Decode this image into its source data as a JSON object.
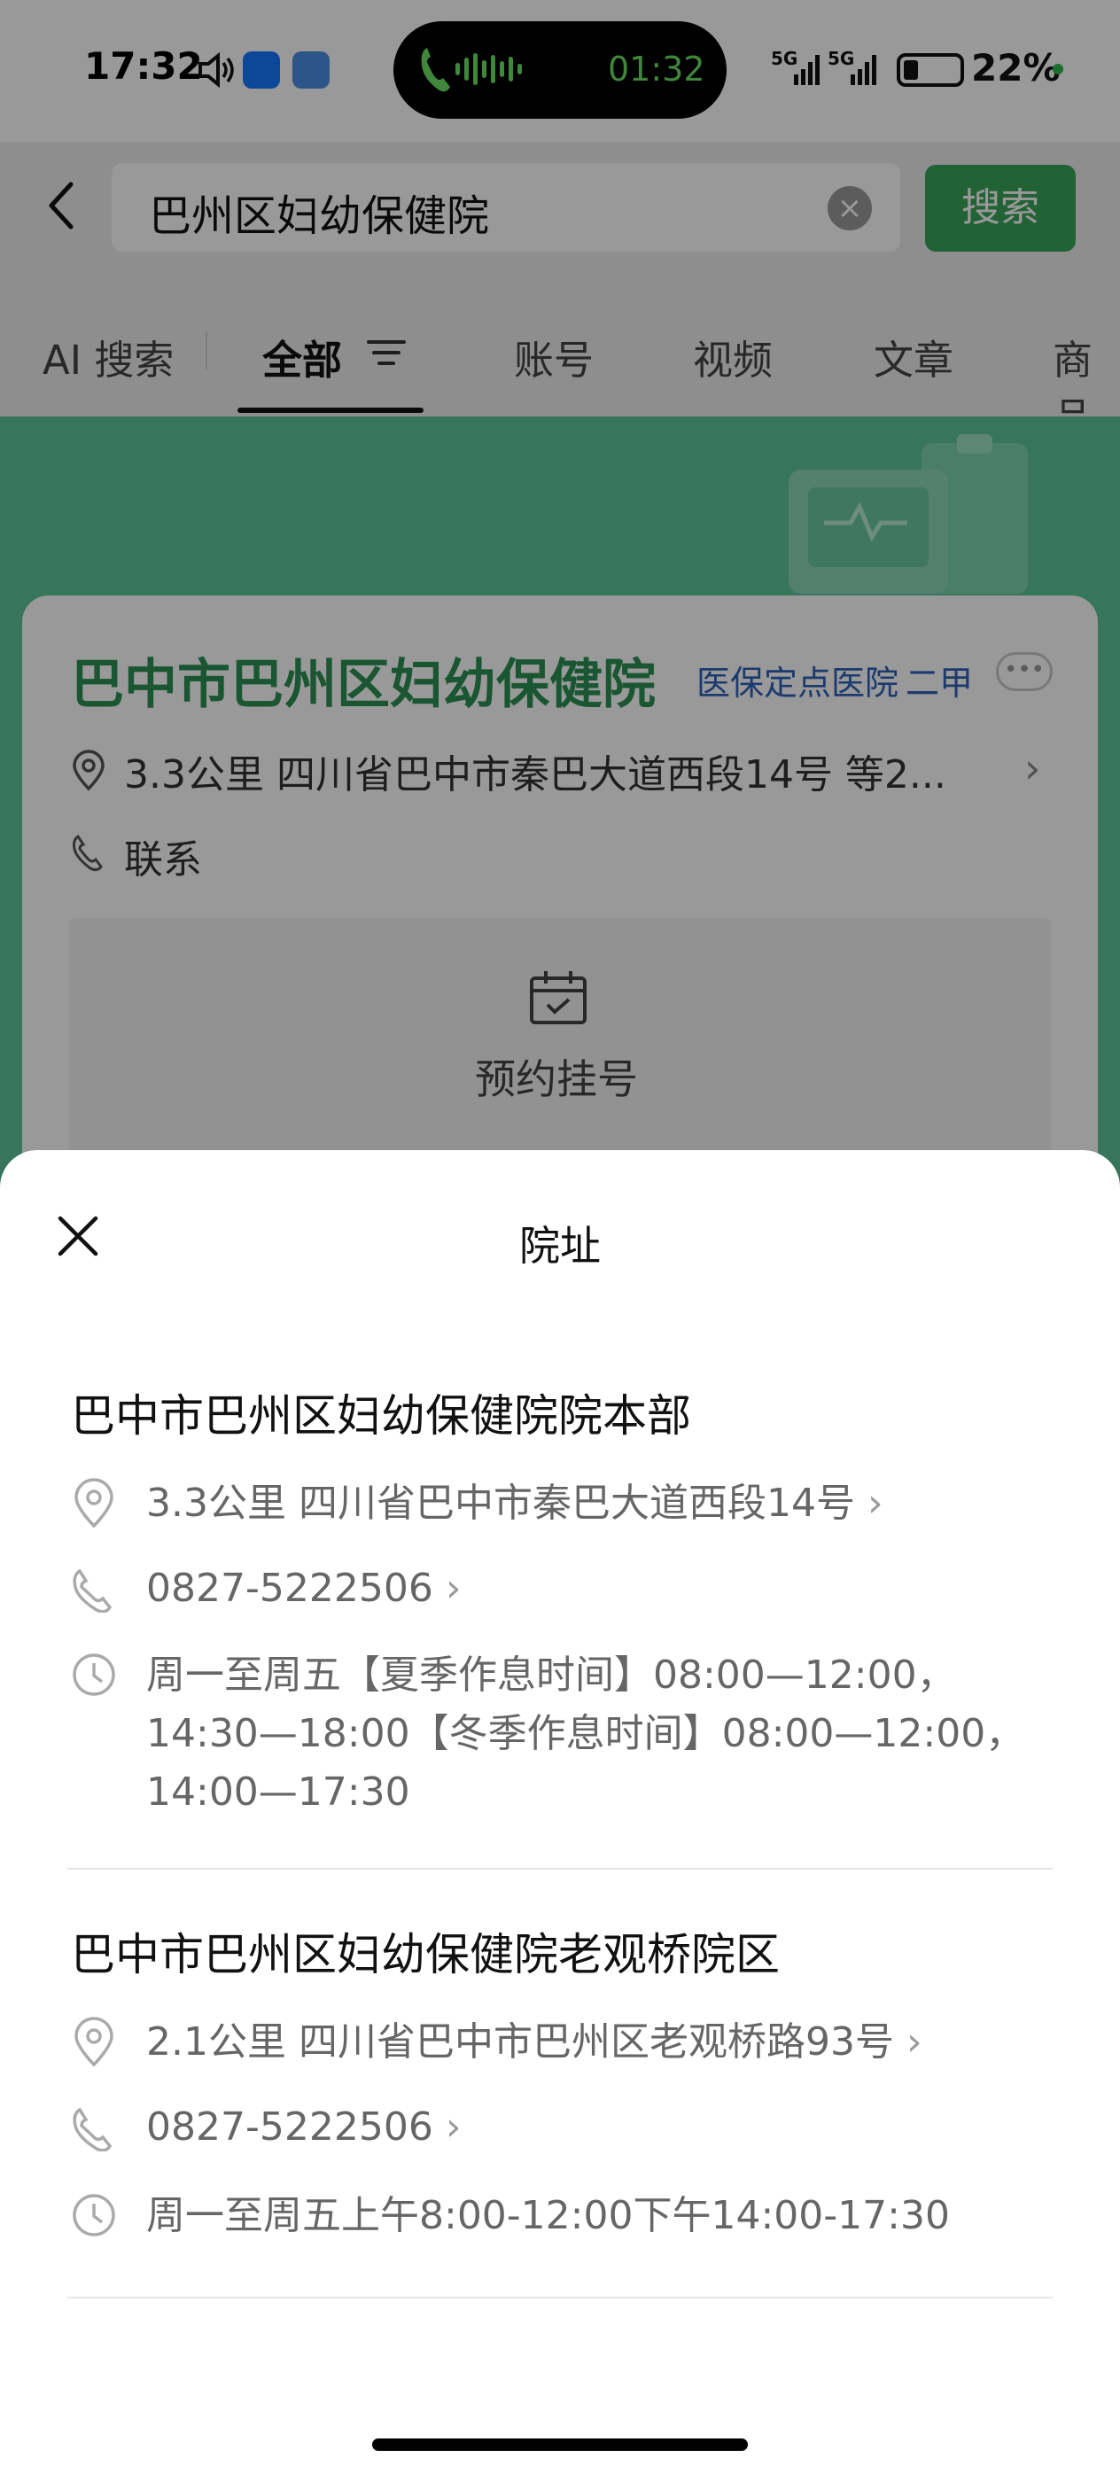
{
  "status_bar": {
    "time": "17:32",
    "call_duration": "01:32",
    "signal_1": "5G",
    "signal_2": "5G",
    "battery": "22%"
  },
  "search": {
    "query": "巴州区妇幼保健院",
    "button_label": "搜索"
  },
  "tabs": [
    {
      "label": "AI 搜索"
    },
    {
      "label": "全部"
    },
    {
      "label": "账号"
    },
    {
      "label": "视频"
    },
    {
      "label": "文章"
    },
    {
      "label": "商品"
    }
  ],
  "hospital_card": {
    "name": "巴中市巴州区妇幼保健院",
    "tag_insurance": "医保定点医院",
    "tag_grade": "二甲",
    "address": "3.3公里 四川省巴中市秦巴大道西段14号 等2...",
    "contact": "联系",
    "booking": "预约挂号"
  },
  "sheet": {
    "title": "院址",
    "branches": [
      {
        "name": "巴中市巴州区妇幼保健院院本部",
        "address": "3.3公里 四川省巴中市秦巴大道西段14号",
        "phone": "0827-5222506",
        "hours_line1": "周一至周五【夏季作息时间】08:00—12:00，",
        "hours_line2": "14:30—18:00【冬季作息时间】08:00—12:00，",
        "hours_line3": "14:00—17:30"
      },
      {
        "name": "巴中市巴州区妇幼保健院老观桥院区",
        "address": "2.1公里 四川省巴中市巴州区老观桥路93号",
        "phone": "0827-5222506",
        "hours_line1": "周一至周五上午8:00-12:00下午14:00-17:30"
      }
    ]
  },
  "colors": {
    "accent_green": "#3aa55a",
    "title_green": "#2b8f52",
    "tag_blue": "#2f62b8",
    "banner_green": "#5cc39b"
  }
}
